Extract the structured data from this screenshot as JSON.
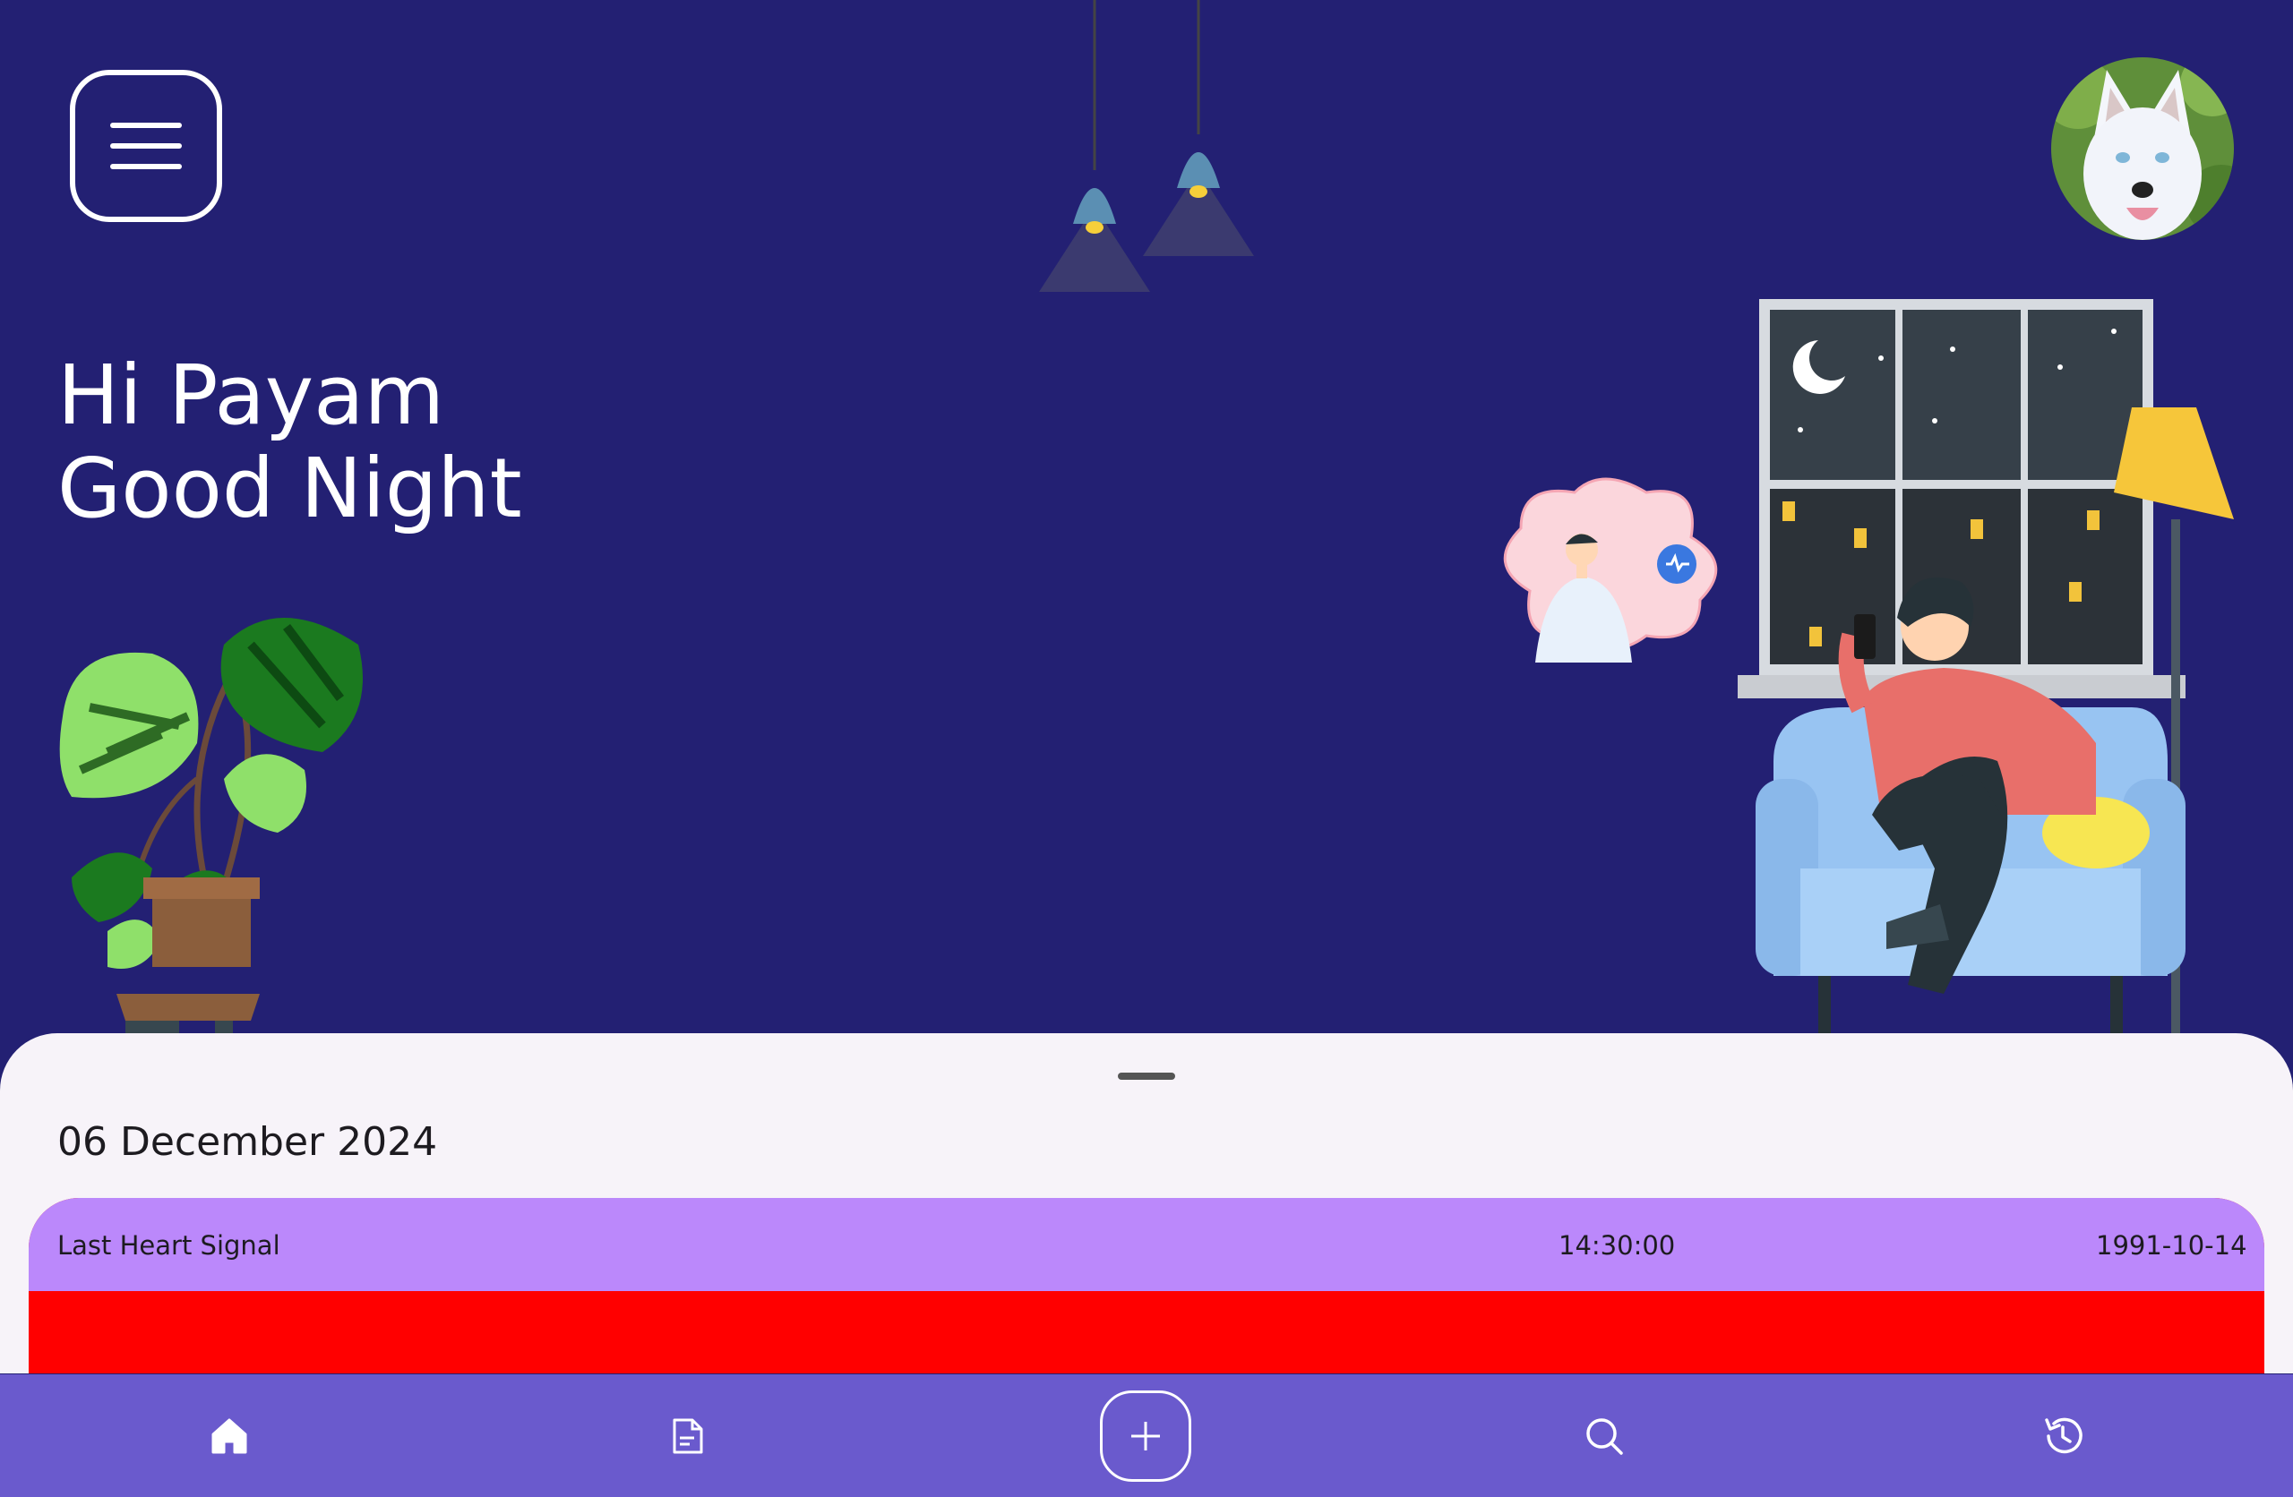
{
  "header": {
    "menu_icon": "hamburger-menu-icon",
    "avatar_alt": "profile-avatar"
  },
  "greeting": {
    "line1": "Hi Payam",
    "line2": "Good Night"
  },
  "sheet": {
    "date": "06 December 2024",
    "card": {
      "title": "Last Heart Signal",
      "time": "14:30:00",
      "date": "1991-10-14",
      "header_color": "#bb88fb",
      "status_color": "#ff0000"
    }
  },
  "bottom_nav": {
    "items": [
      {
        "icon": "home-icon",
        "active": true
      },
      {
        "icon": "document-icon"
      },
      {
        "icon": "add-icon"
      },
      {
        "icon": "search-icon"
      },
      {
        "icon": "history-icon"
      }
    ]
  },
  "colors": {
    "background": "#232073",
    "nav": "#6a5acd",
    "sheet": "#f7f3f9"
  }
}
